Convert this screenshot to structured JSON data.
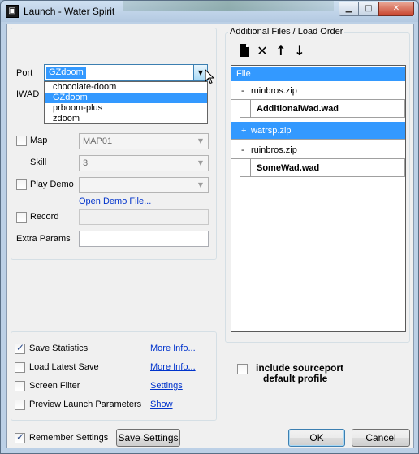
{
  "window": {
    "title": "Launch - Water Spirit",
    "minimize_glyph": "▁",
    "maximize_glyph": "□",
    "close_glyph": "✕"
  },
  "port": {
    "label": "Port",
    "selected": "GZdoom",
    "options": [
      "chocolate-doom",
      "GZdoom",
      "prboom-plus",
      "zdoom"
    ]
  },
  "iwad": {
    "label": "IWAD"
  },
  "map": {
    "label": "Map",
    "checked": false,
    "value": "MAP01"
  },
  "skill": {
    "label": "Skill",
    "value": "3"
  },
  "play_demo": {
    "label": "Play Demo",
    "checked": false,
    "value": "",
    "open_link": "Open Demo File..."
  },
  "record": {
    "label": "Record",
    "checked": false
  },
  "extra_params": {
    "label": "Extra Params",
    "value": ""
  },
  "options": {
    "save_statistics": {
      "label": "Save Statistics",
      "checked": true,
      "link": "More Info..."
    },
    "load_latest_save": {
      "label": "Load Latest Save",
      "checked": false,
      "link": "More Info..."
    },
    "screen_filter": {
      "label": "Screen Filter",
      "checked": false,
      "link": "Settings"
    },
    "preview_launch": {
      "label": "Preview Launch Parameters",
      "checked": false,
      "link": "Show"
    }
  },
  "remember_settings": {
    "label": "Remember Settings",
    "checked": true
  },
  "buttons": {
    "save_settings": "Save Settings",
    "ok": "OK",
    "cancel": "Cancel"
  },
  "files_panel": {
    "title": "Additional Files / Load Order",
    "column_header": "File",
    "toolbar": [
      "new-file-icon",
      "delete-icon",
      "move-up-icon",
      "move-down-icon"
    ],
    "rows": [
      {
        "sign": "-",
        "name": "ruinbros.zip"
      },
      {
        "name": "AdditionalWad.wad"
      },
      {
        "sign": "+",
        "name": "watrsp.zip"
      },
      {
        "sign": "-",
        "name": "ruinbros.zip"
      },
      {
        "name": "SomeWad.wad"
      }
    ]
  },
  "include_profile": {
    "line1": "include sourceport",
    "line2": "default profile",
    "checked": false
  },
  "colors": {
    "accent": "#3399ff",
    "link": "#0033cc",
    "frame": "#bcd0e6"
  }
}
